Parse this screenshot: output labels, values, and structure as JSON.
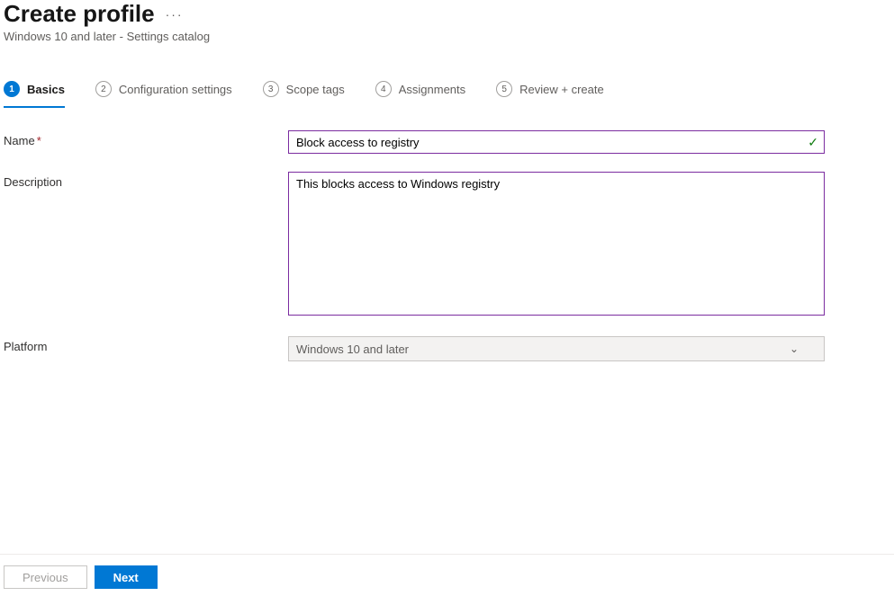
{
  "header": {
    "title": "Create profile",
    "subtitle": "Windows 10 and later - Settings catalog"
  },
  "tabs": [
    {
      "num": "1",
      "label": "Basics",
      "active": true
    },
    {
      "num": "2",
      "label": "Configuration settings",
      "active": false
    },
    {
      "num": "3",
      "label": "Scope tags",
      "active": false
    },
    {
      "num": "4",
      "label": "Assignments",
      "active": false
    },
    {
      "num": "5",
      "label": "Review + create",
      "active": false
    }
  ],
  "form": {
    "name_label": "Name",
    "name_value": "Block access to registry",
    "description_label": "Description",
    "description_value": "This blocks access to Windows registry",
    "platform_label": "Platform",
    "platform_value": "Windows 10 and later"
  },
  "footer": {
    "previous": "Previous",
    "next": "Next"
  }
}
